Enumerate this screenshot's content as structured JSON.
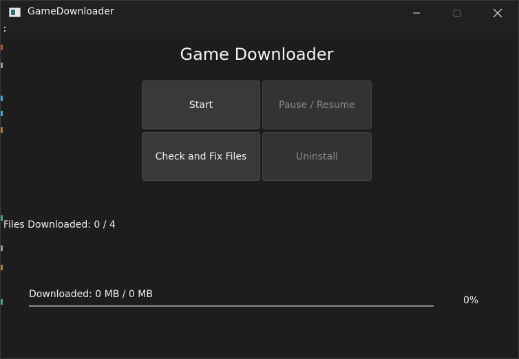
{
  "window": {
    "title": "GameDownloader",
    "icon": "app-window-icon",
    "controls": {
      "minimize_icon": "minimize-icon",
      "maximize_icon": "maximize-icon",
      "close_icon": "close-icon"
    }
  },
  "menu": {
    "icon": "overflow-menu-icon"
  },
  "main": {
    "heading": "Game Downloader",
    "buttons": {
      "start": "Start",
      "pause_resume": "Pause / Resume",
      "check_fix": "Check and Fix Files",
      "uninstall": "Uninstall"
    },
    "files_status": "Files Downloaded: 0 / 4",
    "download_status": "Downloaded: 0 MB / 0 MB",
    "progress": {
      "percent_text": "0%",
      "value": 0
    }
  },
  "colors": {
    "background": "#1d1d1d",
    "button": "#393939",
    "button_disabled_text": "#8a8a8a",
    "text": "#f0f0f0",
    "progress_track": "#8a8a8a"
  }
}
